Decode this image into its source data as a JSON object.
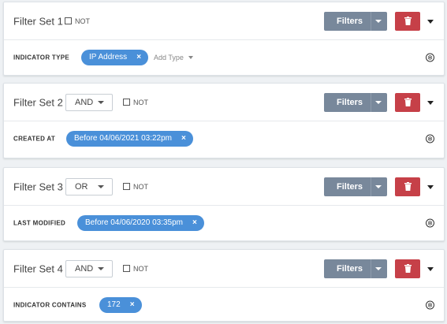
{
  "filter_sets": [
    {
      "title": "Filter Set 1",
      "operator": null,
      "not_label": "NOT",
      "filters_label": "Filters",
      "field_label": "INDICATOR TYPE",
      "pill_value": "IP Address",
      "pill_close": "×",
      "add_type_label": "Add Type",
      "clear_icon": "⊗"
    },
    {
      "title": "Filter Set 2",
      "operator": "AND",
      "not_label": "NOT",
      "filters_label": "Filters",
      "field_label": "CREATED AT",
      "pill_value": "Before 04/06/2021 03:22pm",
      "pill_close": "×",
      "clear_icon": "⊗"
    },
    {
      "title": "Filter Set 3",
      "operator": "OR",
      "not_label": "NOT",
      "filters_label": "Filters",
      "field_label": "LAST MODIFIED",
      "pill_value": "Before 04/06/2020 03:35pm",
      "pill_close": "×",
      "clear_icon": "⊗"
    },
    {
      "title": "Filter Set 4",
      "operator": "AND",
      "not_label": "NOT",
      "filters_label": "Filters",
      "field_label": "INDICATOR CONTAINS",
      "pill_value": "172",
      "pill_close": "×",
      "clear_icon": "⊗"
    }
  ],
  "colors": {
    "filters_button": "#78889b",
    "delete_button": "#c64048",
    "pill": "#4a90d9"
  },
  "icons": {
    "delete": "trash-icon",
    "expand": "caret-down-icon",
    "clear": "clear-circle-icon"
  }
}
